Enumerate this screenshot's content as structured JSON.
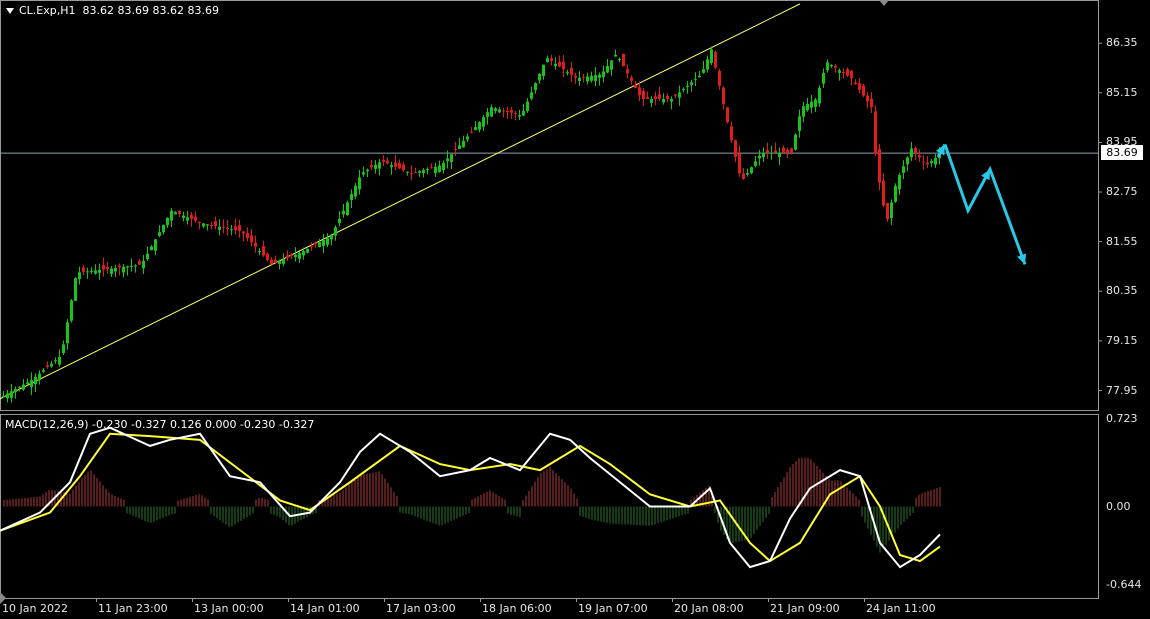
{
  "header": {
    "symbol_label": "CL.Exp,H1",
    "ohlc": "83.62 83.69 83.62 83.69"
  },
  "macd_header": {
    "label": "MACD(12,26,9)",
    "values": "-0.230 -0.327 0.126 0.000 -0.230 -0.327"
  },
  "current_price": "83.69",
  "price_axis": [
    "86.35",
    "85.15",
    "83.95",
    "82.75",
    "81.55",
    "80.35",
    "79.15",
    "77.95"
  ],
  "macd_axis": [
    "0.723",
    "0.00",
    "-0.644"
  ],
  "time_axis": [
    "10 Jan 2022",
    "11 Jan 23:00",
    "13 Jan 00:00",
    "14 Jan 01:00",
    "17 Jan 03:00",
    "18 Jan 06:00",
    "19 Jan 07:00",
    "20 Jan 08:00",
    "21 Jan 09:00",
    "24 Jan 11:00"
  ],
  "colors": {
    "background": "#000000",
    "bull": "#19c419",
    "bear": "#e01c1c",
    "trendline": "#ffff66",
    "macd_main": "#ffffff",
    "macd_signal": "#ffff33",
    "hist_pos": "#b33a3a",
    "hist_neg": "#2a7a2a",
    "forecast_arrow": "#28c8e6"
  },
  "chart_data": [
    {
      "type": "line",
      "panel": "price",
      "ylim": [
        77.6,
        87.2
      ],
      "x_range": [
        0,
        1100
      ],
      "series": [
        {
          "values_xy": [
            [
              0,
              77.8
            ],
            [
              30,
              78.2
            ],
            [
              60,
              78.8
            ],
            [
              75,
              80.8
            ],
            [
              110,
              80.9
            ],
            [
              140,
              81.0
            ],
            [
              170,
              82.3
            ],
            [
              200,
              82.0
            ],
            [
              240,
              81.8
            ],
            [
              270,
              81.0
            ],
            [
              300,
              81.3
            ],
            [
              330,
              81.7
            ],
            [
              360,
              83.2
            ],
            [
              380,
              83.5
            ],
            [
              410,
              83.2
            ],
            [
              440,
              83.4
            ],
            [
              470,
              84.2
            ],
            [
              490,
              84.8
            ],
            [
              520,
              84.6
            ],
            [
              545,
              86.0
            ],
            [
              575,
              85.5
            ],
            [
              600,
              85.6
            ],
            [
              615,
              86.1
            ],
            [
              640,
              85.0
            ],
            [
              670,
              85.0
            ],
            [
              700,
              85.6
            ],
            [
              710,
              86.2
            ],
            [
              730,
              84.0
            ],
            [
              740,
              83.0
            ],
            [
              760,
              83.7
            ],
            [
              790,
              83.7
            ],
            [
              800,
              84.8
            ],
            [
              815,
              85.0
            ],
            [
              825,
              85.9
            ],
            [
              850,
              85.5
            ],
            [
              870,
              84.8
            ],
            [
              875,
              83.4
            ],
            [
              885,
              82.0
            ],
            [
              895,
              83.0
            ],
            [
              910,
              83.8
            ],
            [
              925,
              83.4
            ],
            [
              940,
              83.69
            ]
          ]
        },
        {
          "name": "forecast",
          "values_xy": [
            [
              945,
              83.9
            ],
            [
              968,
              82.3
            ],
            [
              990,
              83.3
            ],
            [
              1025,
              81.0
            ]
          ]
        },
        {
          "name": "trendline",
          "values_xy": [
            [
              0,
              77.75
            ],
            [
              800,
              87.3
            ]
          ]
        }
      ]
    },
    {
      "type": "line",
      "panel": "macd",
      "ylim": [
        -0.73,
        0.73
      ],
      "series": [
        {
          "name": "main",
          "values_xy": [
            [
              0,
              -0.2
            ],
            [
              40,
              -0.05
            ],
            [
              70,
              0.2
            ],
            [
              90,
              0.6
            ],
            [
              110,
              0.65
            ],
            [
              150,
              0.5
            ],
            [
              170,
              0.55
            ],
            [
              200,
              0.6
            ],
            [
              230,
              0.25
            ],
            [
              260,
              0.2
            ],
            [
              290,
              -0.08
            ],
            [
              310,
              -0.05
            ],
            [
              340,
              0.2
            ],
            [
              360,
              0.45
            ],
            [
              380,
              0.6
            ],
            [
              410,
              0.45
            ],
            [
              440,
              0.25
            ],
            [
              470,
              0.3
            ],
            [
              490,
              0.4
            ],
            [
              520,
              0.3
            ],
            [
              550,
              0.6
            ],
            [
              570,
              0.55
            ],
            [
              590,
              0.4
            ],
            [
              620,
              0.2
            ],
            [
              650,
              0.0
            ],
            [
              690,
              0.0
            ],
            [
              710,
              0.15
            ],
            [
              730,
              -0.3
            ],
            [
              750,
              -0.5
            ],
            [
              770,
              -0.45
            ],
            [
              790,
              -0.1
            ],
            [
              810,
              0.15
            ],
            [
              840,
              0.3
            ],
            [
              860,
              0.25
            ],
            [
              880,
              -0.3
            ],
            [
              900,
              -0.5
            ],
            [
              920,
              -0.4
            ],
            [
              940,
              -0.23
            ]
          ]
        },
        {
          "name": "signal",
          "values_xy": [
            [
              0,
              -0.2
            ],
            [
              50,
              -0.05
            ],
            [
              80,
              0.25
            ],
            [
              110,
              0.6
            ],
            [
              150,
              0.58
            ],
            [
              200,
              0.55
            ],
            [
              240,
              0.3
            ],
            [
              280,
              0.05
            ],
            [
              310,
              -0.03
            ],
            [
              350,
              0.2
            ],
            [
              400,
              0.5
            ],
            [
              440,
              0.35
            ],
            [
              470,
              0.3
            ],
            [
              510,
              0.35
            ],
            [
              540,
              0.3
            ],
            [
              580,
              0.5
            ],
            [
              610,
              0.35
            ],
            [
              650,
              0.1
            ],
            [
              690,
              0.0
            ],
            [
              720,
              0.05
            ],
            [
              750,
              -0.3
            ],
            [
              770,
              -0.45
            ],
            [
              800,
              -0.3
            ],
            [
              830,
              0.1
            ],
            [
              860,
              0.25
            ],
            [
              880,
              0.0
            ],
            [
              900,
              -0.4
            ],
            [
              920,
              -0.45
            ],
            [
              940,
              -0.33
            ]
          ]
        }
      ]
    }
  ]
}
